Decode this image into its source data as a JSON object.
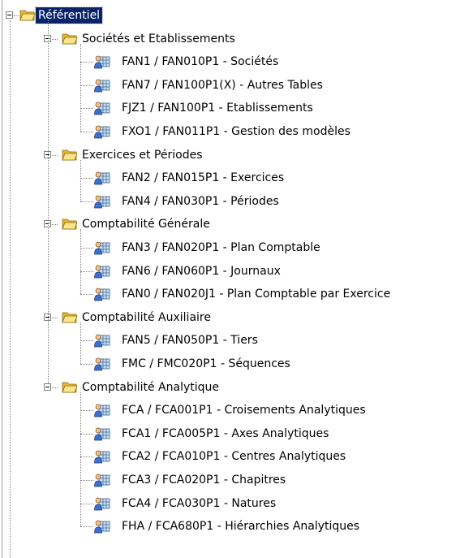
{
  "tree": {
    "root": {
      "label": "Référentiel",
      "icon": "folder-open-icon",
      "selected": true
    },
    "groups": [
      {
        "label": "Sociétés et Etablissements",
        "icon": "folder-open-icon",
        "items": [
          {
            "label": "FAN1 / FAN010P1 - Sociétés",
            "icon": "user-form-icon"
          },
          {
            "label": "FAN7 / FAN100P1(X) - Autres Tables",
            "icon": "user-form-icon"
          },
          {
            "label": "FJZ1 / FAN100P1 - Etablissements",
            "icon": "user-form-icon"
          },
          {
            "label": "FXO1 / FAN011P1 - Gestion des modèles",
            "icon": "user-form-icon"
          }
        ]
      },
      {
        "label": "Exercices et Périodes",
        "icon": "folder-open-icon",
        "items": [
          {
            "label": "FAN2 / FAN015P1 - Exercices",
            "icon": "user-form-icon"
          },
          {
            "label": "FAN4 / FAN030P1 - Périodes",
            "icon": "user-form-icon"
          }
        ]
      },
      {
        "label": "Comptabilité Générale",
        "icon": "folder-open-icon",
        "items": [
          {
            "label": "FAN3 / FAN020P1 - Plan Comptable",
            "icon": "user-form-icon"
          },
          {
            "label": "FAN6 / FAN060P1 - Journaux",
            "icon": "user-form-icon"
          },
          {
            "label": "FAN0 / FAN020J1 - Plan Comptable par Exercice",
            "icon": "user-form-icon"
          }
        ]
      },
      {
        "label": "Comptabilité Auxiliaire",
        "icon": "folder-open-icon",
        "items": [
          {
            "label": "FAN5 / FAN050P1 - Tiers",
            "icon": "user-form-icon"
          },
          {
            "label": "FMC / FMC020P1 - Séquences",
            "icon": "user-form-icon"
          }
        ]
      },
      {
        "label": "Comptabilité Analytique",
        "icon": "folder-open-icon",
        "items": [
          {
            "label": "FCA / FCA001P1 - Croisements Analytiques",
            "icon": "user-form-icon"
          },
          {
            "label": "FCA1 / FCA005P1 - Axes Analytiques",
            "icon": "user-form-icon"
          },
          {
            "label": "FCA2 / FCA010P1 - Centres Analytiques",
            "icon": "user-form-icon"
          },
          {
            "label": "FCA3 / FCA020P1 - Chapitres",
            "icon": "user-form-icon"
          },
          {
            "label": "FCA4 / FCA030P1 - Natures",
            "icon": "user-form-icon"
          },
          {
            "label": "FHA / FCA680P1 - Hiérarchies Analytiques",
            "icon": "user-form-icon"
          }
        ]
      }
    ]
  },
  "colors": {
    "selection_bg": "#0a246a",
    "selection_fg": "#ffffff",
    "folder": "#f5d86a",
    "tree_line": "#808080"
  }
}
